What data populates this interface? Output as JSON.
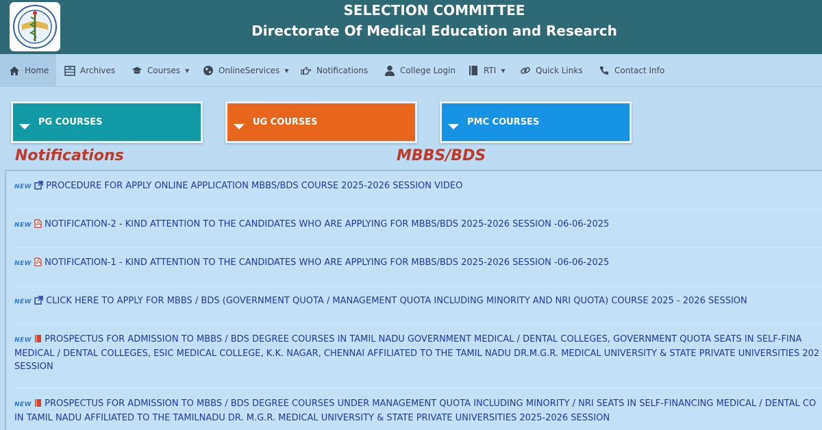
{
  "header": {
    "title_line1": "SELECTION COMMITTEE",
    "title_line2": "Directorate Of Medical Education and Research",
    "logo_icon": "caduceus-seal-logo"
  },
  "nav": {
    "items": [
      {
        "label": "Home",
        "icon": "home-icon",
        "active": true
      },
      {
        "label": "Archives",
        "icon": "archive-icon"
      },
      {
        "label": "Courses",
        "icon": "graduation-cap-icon",
        "dropdown": true
      },
      {
        "label": "OnlineServices",
        "icon": "globe-icon",
        "dropdown": true
      },
      {
        "label": "Notifications",
        "icon": "hand-pointer-icon"
      },
      {
        "label": "College Login",
        "icon": "user-icon"
      },
      {
        "label": "RTI",
        "icon": "book-icon",
        "dropdown": true
      },
      {
        "label": "Quick Links",
        "icon": "link-icon"
      },
      {
        "label": "Contact Info",
        "icon": "phone-icon"
      }
    ]
  },
  "courses": {
    "pg": "PG COURSES",
    "ug": "UG COURSES",
    "pmc": "PMC COURSES",
    "colors": {
      "pg": "#129aa6",
      "ug": "#e8651c",
      "pmc": "#1693e5"
    }
  },
  "sections": {
    "notifications_heading": "Notifications",
    "mbbs_heading": "MBBS/BDS"
  },
  "notifications": [
    {
      "badge": "NEW",
      "icon": "external-link-icon",
      "lines": [
        "PROCEDURE FOR APPLY ONLINE APPLICATION MBBS/BDS COURSE 2025-2026 SESSION VIDEO"
      ]
    },
    {
      "badge": "NEW",
      "icon": "pdf-icon",
      "lines": [
        "NOTIFICATION-2 - KIND ATTENTION TO THE CANDIDATES WHO ARE APPLYING FOR MBBS/BDS 2025-2026 SESSION -06-06-2025"
      ]
    },
    {
      "badge": "NEW",
      "icon": "pdf-icon",
      "lines": [
        "NOTIFICATION-1 - KIND ATTENTION TO THE CANDIDATES WHO ARE APPLYING FOR MBBS/BDS 2025-2026 SESSION -06-06-2025"
      ]
    },
    {
      "badge": "NEW",
      "icon": "external-link-icon",
      "lines": [
        "CLICK HERE TO APPLY FOR MBBS / BDS (GOVERNMENT QUOTA / MANAGEMENT QUOTA INCLUDING MINORITY AND NRI QUOTA) COURSE 2025 - 2026 SESSION"
      ]
    },
    {
      "badge": "NEW",
      "icon": "book-icon",
      "lines": [
        "PROSPECTUS FOR ADMISSION TO MBBS / BDS DEGREE COURSES IN TAMIL NADU GOVERNMENT MEDICAL / DENTAL COLLEGES, GOVERNMENT QUOTA SEATS IN SELF-FINA",
        "MEDICAL / DENTAL COLLEGES, ESIC MEDICAL COLLEGE, K.K. NAGAR, CHENNAI AFFILIATED TO THE TAMIL NADU DR.M.G.R. MEDICAL UNIVERSITY & STATE PRIVATE UNIVERSITIES 202",
        "SESSION"
      ]
    },
    {
      "badge": "NEW",
      "icon": "book-icon",
      "lines": [
        "PROSPECTUS FOR ADMISSION TO MBBS / BDS DEGREE COURSES UNDER MANAGEMENT QUOTA INCLUDING MINORITY / NRI SEATS IN SELF-FINANCING MEDICAL / DENTAL CO",
        "IN TAMIL NADU AFFILIATED TO THE TAMILNADU DR. M.G.R. MEDICAL UNIVERSITY & STATE PRIVATE UNIVERSITIES 2025-2026 SESSION"
      ]
    }
  ]
}
